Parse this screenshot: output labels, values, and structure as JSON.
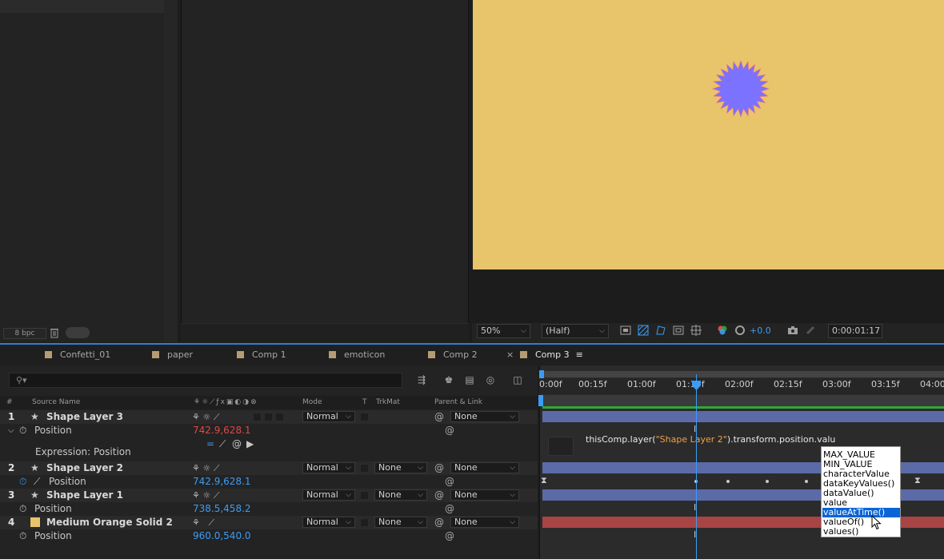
{
  "project_panel": {
    "bpc_label": "8 bpc"
  },
  "viewer": {
    "zoom": "50%",
    "resolution": "(Half)",
    "exposure": "+0.0",
    "timecode": "0:00:01:17",
    "colors": {
      "comp_background": "#e8c46a",
      "sunburst": "#7b72ff",
      "sunburst_edge": "#e66a8a"
    }
  },
  "tabs": [
    {
      "label": "Confetti_01",
      "active": false
    },
    {
      "label": "paper",
      "active": false
    },
    {
      "label": "Comp 1",
      "active": false
    },
    {
      "label": "emoticon",
      "active": false
    },
    {
      "label": "Comp 2",
      "active": false
    },
    {
      "label": "Comp 3",
      "active": true
    }
  ],
  "tab_close": "×",
  "tab_menu": "≡",
  "timeline": {
    "search_placeholder": "",
    "columns": {
      "hash": "#",
      "source_name": "Source Name",
      "mode": "Mode",
      "t": "T",
      "trkmat": "TrkMat",
      "parent": "Parent & Link"
    },
    "layers": [
      {
        "num": "1",
        "name": "Shape Layer 3",
        "mode": "Normal",
        "trkmat": "",
        "parent": "None",
        "prop": "Position",
        "value": "742.9,628.1",
        "value_color": "red",
        "expression_label": "Expression: Position"
      },
      {
        "num": "2",
        "name": "Shape Layer 2",
        "mode": "Normal",
        "trkmat": "None",
        "parent": "None",
        "prop": "Position",
        "value": "742.9,628.1",
        "value_color": "blue"
      },
      {
        "num": "3",
        "name": "Shape Layer 1",
        "mode": "Normal",
        "trkmat": "None",
        "parent": "None",
        "prop": "Position",
        "value": "738.5,458.2",
        "value_color": "blue"
      },
      {
        "num": "4",
        "name": "Medium Orange Solid 2",
        "mode": "Normal",
        "trkmat": "None",
        "parent": "None",
        "prop": "Position",
        "value": "960.0,540.0",
        "value_color": "blue"
      }
    ],
    "ruler_ticks": [
      "0:00f",
      "00:15f",
      "01:00f",
      "01:15f",
      "02:00f",
      "02:15f",
      "03:00f",
      "03:15f",
      "04:00f"
    ],
    "expression": {
      "prefix": "thisComp.layer(",
      "string": "\"Shape Layer 2\"",
      "suffix": ").transform.position.valu"
    },
    "autocomplete": [
      {
        "label": "MAX_VALUE",
        "selected": false
      },
      {
        "label": "MIN_VALUE",
        "selected": false
      },
      {
        "label": "characterValue",
        "selected": false
      },
      {
        "label": "dataKeyValues()",
        "selected": false
      },
      {
        "label": "dataValue()",
        "selected": false
      },
      {
        "label": "value",
        "selected": false
      },
      {
        "label": "valueAtTime()",
        "selected": true
      },
      {
        "label": "valueOf()",
        "selected": false
      },
      {
        "label": "values()",
        "selected": false
      }
    ],
    "colors": {
      "layer_bar": "#5c6aa8",
      "solid_bar": "#a84444",
      "solid_swatch": "#e8c46a",
      "playhead": "#3a9df5",
      "work_area": "#2fa83a"
    }
  }
}
